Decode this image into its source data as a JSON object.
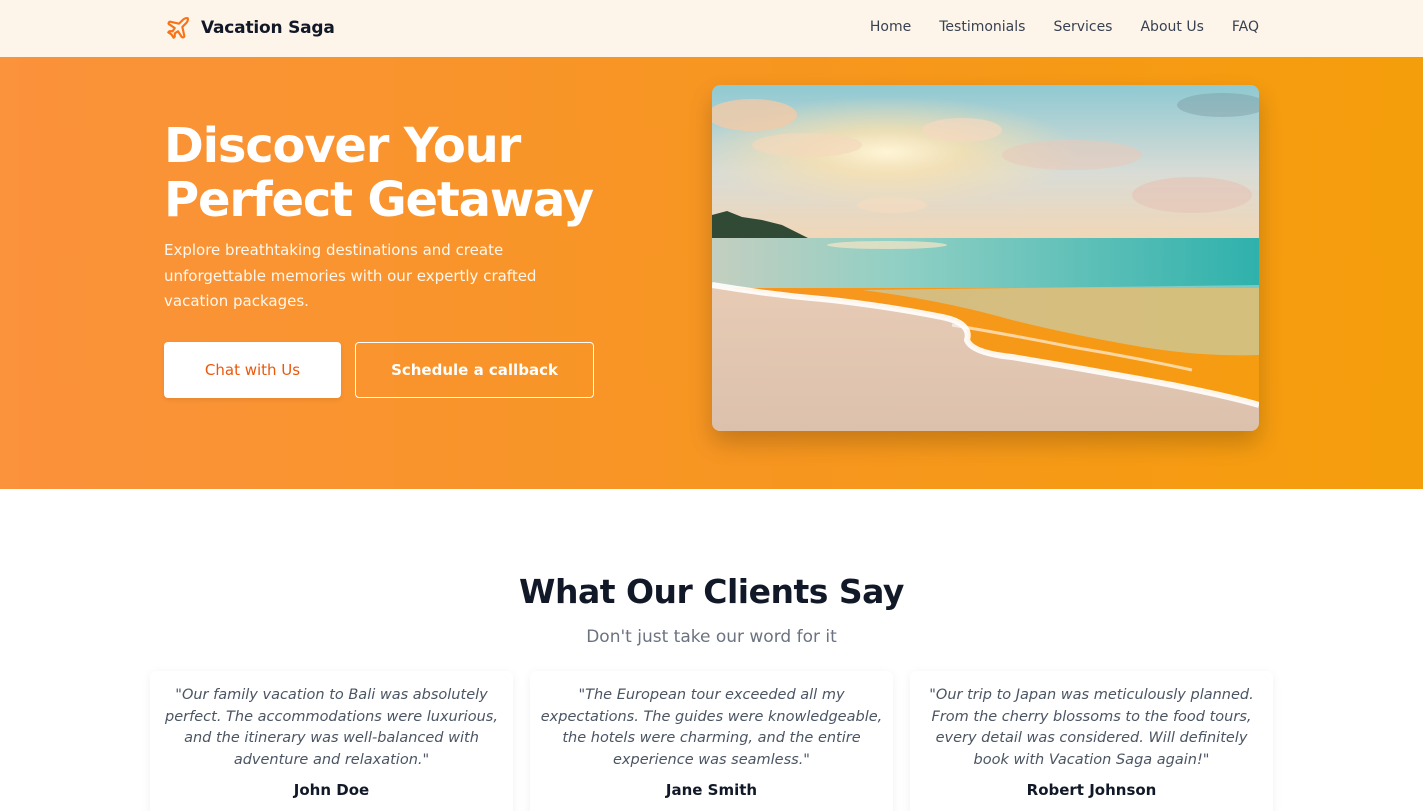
{
  "nav": {
    "brand": "Vacation Saga",
    "brand_icon": "airplane-icon",
    "links": [
      "Home",
      "Testimonials",
      "Services",
      "About Us",
      "FAQ"
    ]
  },
  "hero": {
    "title_line1": "Discover Your",
    "title_line2": "Perfect Getaway",
    "subtitle": "Explore breathtaking destinations and create unforgettable memories with our expertly crafted vacation packages.",
    "primary_button": "Chat with Us",
    "secondary_button": "Schedule a callback",
    "image": "beach-sunset-photo"
  },
  "testimonials": {
    "title": "What Our Clients Say",
    "subtitle": "Don't just take our word for it",
    "items": [
      {
        "quote": "\"Our family vacation to Bali was absolutely perfect. The accommodations were luxurious, and the itinerary was well-balanced with adventure and relaxation.\"",
        "name": "John Doe"
      },
      {
        "quote": "\"The European tour exceeded all my expectations. The guides were knowledgeable, the hotels were charming, and the entire experience was seamless.\"",
        "name": "Jane Smith"
      },
      {
        "quote": "\"Our trip to Japan was meticulously planned. From the cherry blossoms to the food tours, every detail was considered. Will definitely book with Vacation Saga again!\"",
        "name": "Robert Johnson"
      }
    ]
  },
  "colors": {
    "accent": "#ea580c",
    "hero_gradient_start": "#fb923c",
    "hero_gradient_end": "#f59e0b",
    "nav_background": "#fef5ea"
  }
}
